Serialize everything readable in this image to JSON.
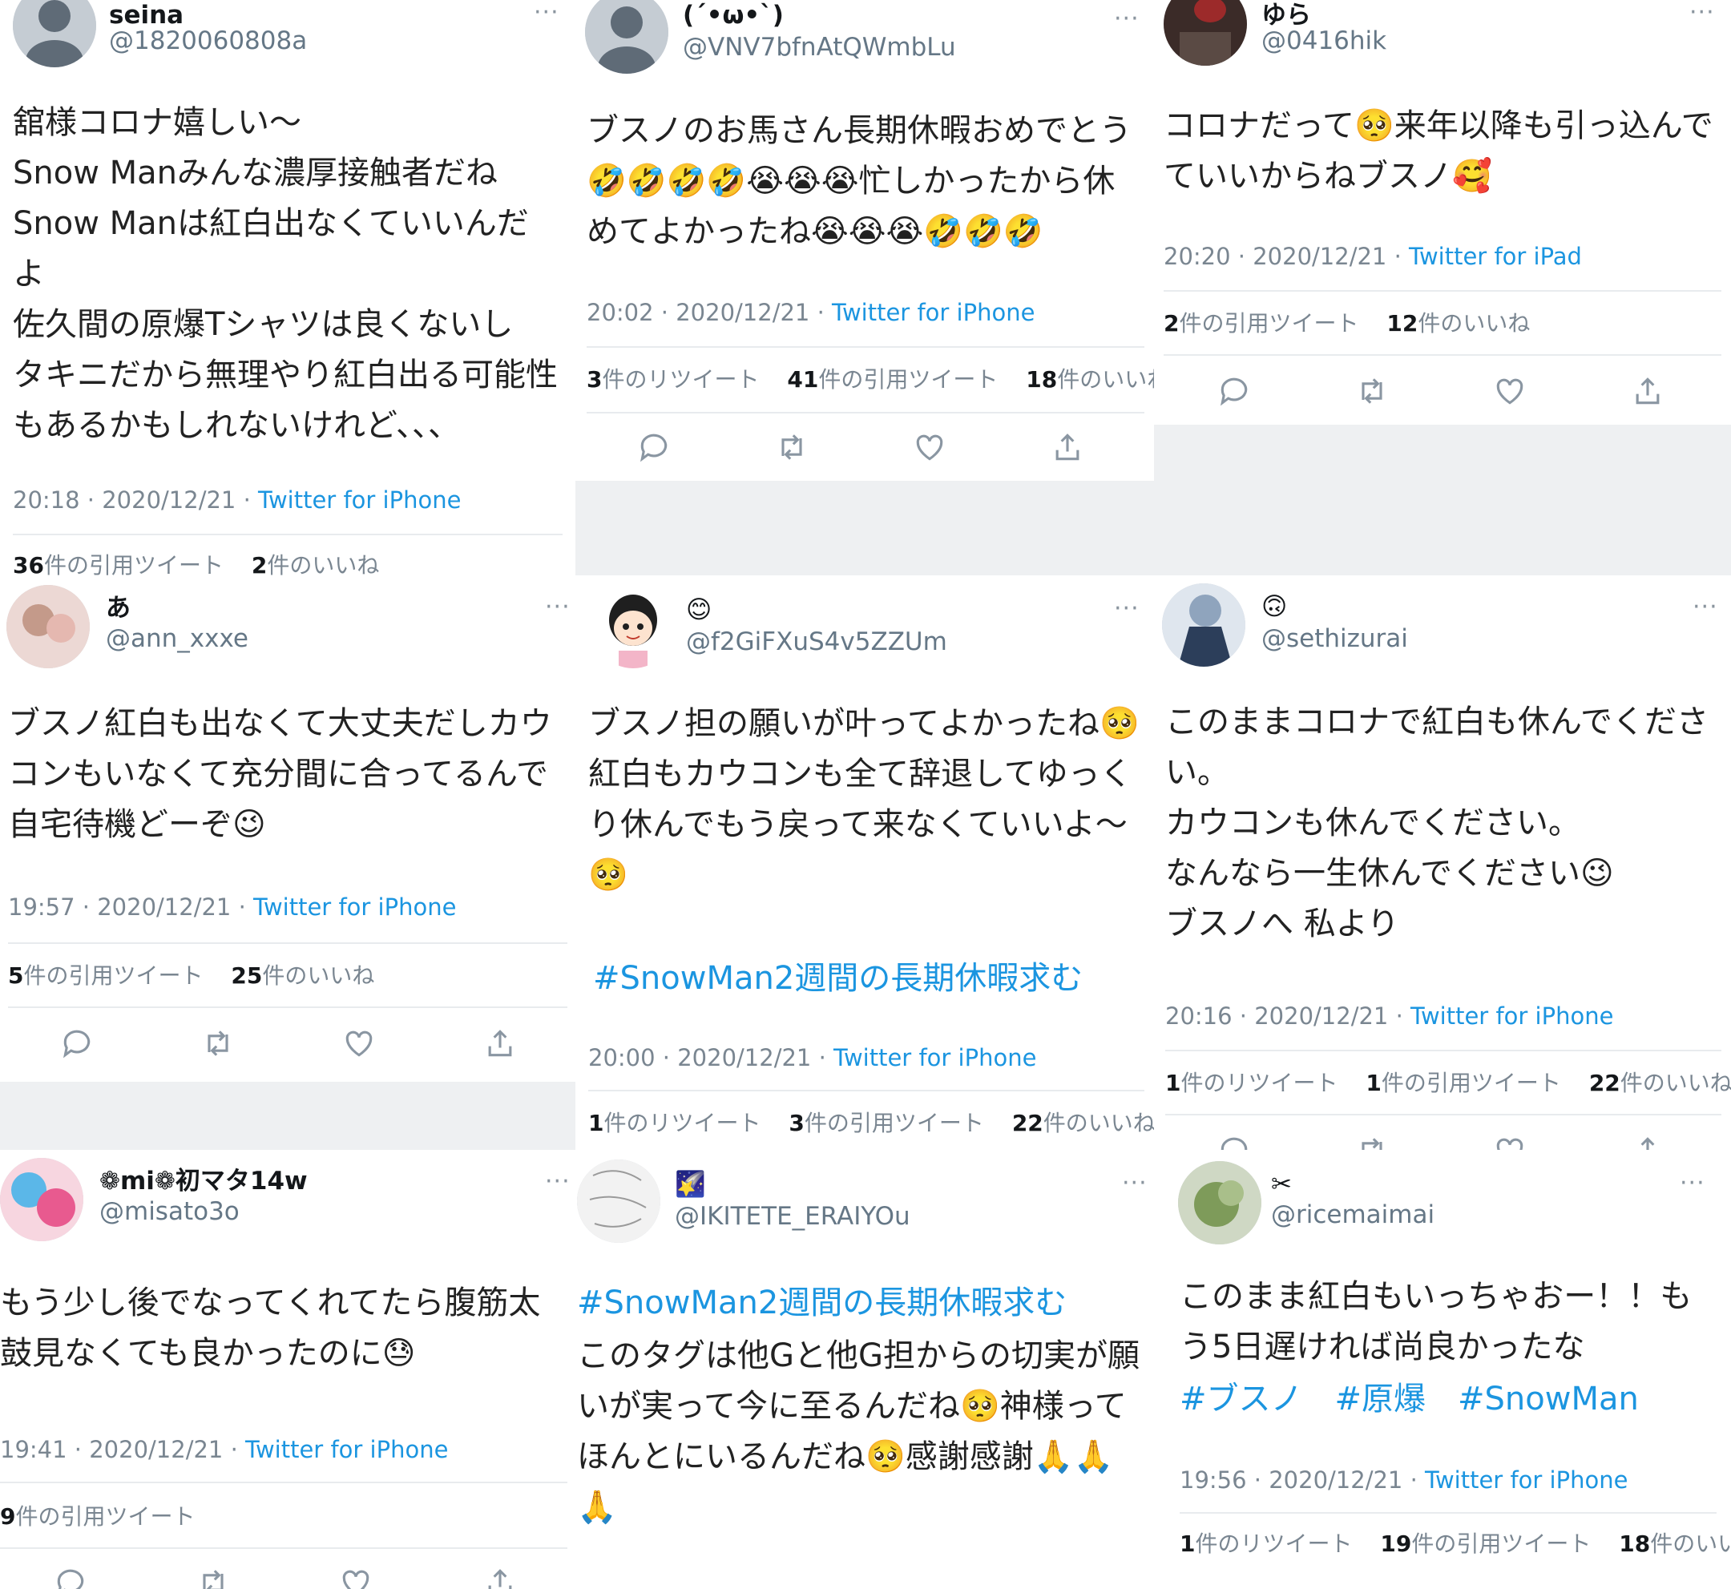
{
  "tweets": [
    {
      "name": "seina",
      "handle": "@1820060808a",
      "more": "···",
      "body": "舘様コロナ嬉しい〜\nSnow Manみんな濃厚接触者だね\nSnow Manは紅白出なくていいんだよ\n佐久間の原爆Tシャツは良くないし\nタキニだから無理やり紅白出る可能性もあるかもしれないけれど、、、",
      "time": "20:18 · 2020/12/21 · ",
      "source": "Twitter for iPhone",
      "stats": [
        {
          "n": "36",
          "label": "件の引用ツイート"
        },
        {
          "n": "2",
          "label": "件のいいね"
        }
      ]
    },
    {
      "name": "(ˊ•ω•ˋ)",
      "handle": "@VNV7bfnAtQWmbLu",
      "more": "···",
      "body": "ブスノのお馬さん長期休暇おめでとう🤣🤣🤣🤣😭😭😭忙しかったから休めてよかったね😭😭😭🤣🤣🤣",
      "time": "20:02 · 2020/12/21 · ",
      "source": "Twitter for iPhone",
      "stats": [
        {
          "n": "3",
          "label": "件のリツイート"
        },
        {
          "n": "41",
          "label": "件の引用ツイート"
        },
        {
          "n": "18",
          "label": "件のいいね"
        }
      ]
    },
    {
      "name": "ゆら",
      "handle": "@0416hik",
      "more": "···",
      "body": "コロナだって🥺来年以降も引っ込んでていいからねブスノ🥰",
      "time": "20:20 · 2020/12/21 · ",
      "source": "Twitter for iPad",
      "stats": [
        {
          "n": "2",
          "label": "件の引用ツイート"
        },
        {
          "n": "12",
          "label": "件のいいね"
        }
      ]
    },
    {
      "name": "あ",
      "handle": "@ann_xxxe",
      "more": "···",
      "body": "ブスノ紅白も出なくて大丈夫だしカウコンもいなくて充分間に合ってるんで自宅待機どーぞ😉",
      "time": "19:57 · 2020/12/21 · ",
      "source": "Twitter for iPhone",
      "stats": [
        {
          "n": "5",
          "label": "件の引用ツイート"
        },
        {
          "n": "25",
          "label": "件のいいね"
        }
      ]
    },
    {
      "name": "😊",
      "handle": "@f2GiFXuS4v5ZZUm",
      "more": "···",
      "body": "ブスノ担の願いが叶ってよかったね🥺\n紅白もカウコンも全て辞退してゆっくり休んでもう戻って来なくていいよ〜🥺",
      "hashtags": "#SnowMan2週間の長期休暇求む",
      "time": "20:00 · 2020/12/21 · ",
      "source": "Twitter for iPhone",
      "stats": [
        {
          "n": "1",
          "label": "件のリツイート"
        },
        {
          "n": "3",
          "label": "件の引用ツイート"
        },
        {
          "n": "22",
          "label": "件のいいね"
        }
      ]
    },
    {
      "name": "🙃",
      "handle": "@sethizurai",
      "more": "···",
      "body": "このままコロナで紅白も休んでください。\nカウコンも休んでください。\nなんなら一生休んでください😉\nブスノへ 私より",
      "time": "20:16 · 2020/12/21 · ",
      "source": "Twitter for iPhone",
      "stats": [
        {
          "n": "1",
          "label": "件のリツイート"
        },
        {
          "n": "1",
          "label": "件の引用ツイート"
        },
        {
          "n": "22",
          "label": "件のいいね"
        }
      ]
    },
    {
      "name": "❁mi❁初マタ14w",
      "handle": "@misato3o",
      "more": "···",
      "body": "もう少し後でなってくれてたら腹筋太鼓見なくても良かったのに😓",
      "time": "19:41 · 2020/12/21 · ",
      "source": "Twitter for iPhone",
      "stats": [
        {
          "n": "9",
          "label": "件の引用ツイート"
        }
      ]
    },
    {
      "name": "🌠",
      "handle": "@IKITETE_ERAIYOu",
      "more": "···",
      "hashtags_top": "#SnowMan2週間の長期休暇求む",
      "body": "このタグは他Gと他G担からの切実が願いが実って今に至るんだね🥺神様ってほんとにいるんだね🥺感謝感謝🙏🙏🙏"
    },
    {
      "name": "✂",
      "handle": "@ricemaimai",
      "more": "···",
      "body": "このまま紅白もいっちゃおー！！もう5日遅ければ尚良かったな",
      "hashtags": "#ブスノ　#原爆　#SnowMan",
      "time": "19:56 · 2020/12/21 · ",
      "source": "Twitter for iPhone",
      "stats": [
        {
          "n": "1",
          "label": "件のリツイート"
        },
        {
          "n": "19",
          "label": "件の引用ツイート"
        },
        {
          "n": "18",
          "label": "件のいいね"
        }
      ]
    }
  ],
  "icons": {
    "reply": "reply-icon",
    "retweet": "retweet-icon",
    "like": "heart-icon",
    "share": "share-icon"
  },
  "colors": {
    "link": "#1b95e0",
    "muted": "#7a8691",
    "divider": "#e8ebee",
    "background_gap": "#eef0f2"
  }
}
